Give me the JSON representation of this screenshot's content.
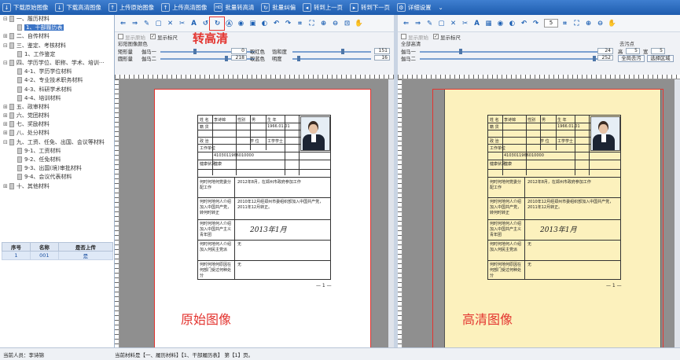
{
  "toolbar": {
    "items": [
      {
        "label": "下载原始图像",
        "icon": "download-icon"
      },
      {
        "label": "下载高清图像",
        "icon": "download-icon"
      },
      {
        "label": "上传原始图像",
        "icon": "upload-icon"
      },
      {
        "label": "上传高清图像",
        "icon": "upload-icon"
      },
      {
        "label": "批量转高清",
        "icon": "hd-icon",
        "badge": "HD"
      },
      {
        "label": "批量纠偏",
        "icon": "deskew-icon"
      },
      {
        "label": "转到上一页",
        "icon": "prev-page-icon"
      },
      {
        "label": "转到下一页",
        "icon": "next-page-icon"
      },
      {
        "label": "详细设置",
        "icon": "settings-icon"
      }
    ]
  },
  "tree": [
    {
      "label": "一、履历材料",
      "level": 0,
      "expanded": true
    },
    {
      "label": "1、干部履历表",
      "level": 1,
      "selected": true
    },
    {
      "label": "二、自传材料",
      "level": 0
    },
    {
      "label": "三、鉴定、考核材料",
      "level": 0,
      "expanded": true
    },
    {
      "label": "1、工作鉴定",
      "level": 1
    },
    {
      "label": "四、学历学位、职称、学术、培训···",
      "level": 0,
      "expanded": true
    },
    {
      "label": "4-1、学历学位材料",
      "level": 1
    },
    {
      "label": "4-2、专业技术职务材料",
      "level": 1
    },
    {
      "label": "4-3、科研学术材料",
      "level": 1
    },
    {
      "label": "4-4、培训材料",
      "level": 1
    },
    {
      "label": "五、政审材料",
      "level": 0
    },
    {
      "label": "六、党团材料",
      "level": 0
    },
    {
      "label": "七、奖励材料",
      "level": 0
    },
    {
      "label": "八、处分材料",
      "level": 0
    },
    {
      "label": "九、工资、任免、出国、会议等材料",
      "level": 0,
      "expanded": true
    },
    {
      "label": "9-1、工资材料",
      "level": 1
    },
    {
      "label": "9-2、任免材料",
      "level": 1
    },
    {
      "label": "9-3、出国(境)审批材料",
      "level": 1
    },
    {
      "label": "9-4、会议代表材料",
      "level": 1
    },
    {
      "label": "十、其他材料",
      "level": 0
    }
  ],
  "grid": {
    "headers": [
      "序号",
      "名称",
      "是否上传"
    ],
    "rows": [
      [
        "1",
        "001",
        "是"
      ]
    ]
  },
  "left_pane": {
    "checkboxes": [
      {
        "label": "显示原始",
        "checked": false
      },
      {
        "label": "显示标尺",
        "checked": true
      }
    ],
    "section": "彩阳图像颜色",
    "sliders": [
      {
        "label": "矩形量",
        "label2": "伽马一",
        "value": "0",
        "value2": "151",
        "value3": "取红色",
        "value4": "饱和度"
      },
      {
        "label": "圆形量",
        "label2": "伽马二",
        "value": "218",
        "value2": "16",
        "value3": "取蓝色",
        "value4": "明度"
      }
    ],
    "big_label": "原始图像"
  },
  "right_pane": {
    "checkboxes": [
      {
        "label": "显示原始",
        "checked": false
      },
      {
        "label": "显示标尺",
        "checked": true
      }
    ],
    "section": "全部高清",
    "section2": "去污点",
    "page_input": "5",
    "sliders": [
      {
        "label": "伽马一",
        "value": "24",
        "label3": "高",
        "value3": "5",
        "label4": "宽",
        "value4": "5"
      },
      {
        "label": "伽马二",
        "value": "252",
        "btn1": "全局去污",
        "btn2": "选择区域"
      }
    ],
    "big_label": "高清图像"
  },
  "overlay_label": "转高清",
  "form": {
    "name_label": "姓  名",
    "name": "李诗锦",
    "gender_label": "性别",
    "gender": "男",
    "age_label": "生  年",
    "birth": "1966.01.01",
    "origin_label": "籍  贯",
    "edu_label": "学 位",
    "degree": "工学学士",
    "party_label": "政  治",
    "work_label": "工作单位",
    "idno": "4103011966010000",
    "health_label": "健康状况",
    "health": "健康",
    "q1": "何时何地何党委分配工作",
    "a1": "2012年8月，在郑州市政府参加工作",
    "q2": "何时何地何人介绍加入中国共产党，转何时转正",
    "a2": "2010年12月经郑州市委组织部加入中国共产党，2011年12月转正。",
    "q3": "何时何地何人介绍加入中国共产主义青年团",
    "sig": "2013年1月",
    "q4": "何时何地何人介绍加入何民主党派",
    "a4": "无",
    "q5": "何时何地何原因在何部门受过何种处分",
    "a5": "无",
    "page": "— 1 —"
  },
  "status": {
    "user_label": "当前人员：",
    "user": "李诗锦",
    "current": "当前材料是【一、履历材料】【1、干部履历表】 第【1】页。"
  },
  "colors": {
    "accent": "#1e5cae",
    "highlight": "#e3342f",
    "hd_paper": "#fcf1bd"
  }
}
